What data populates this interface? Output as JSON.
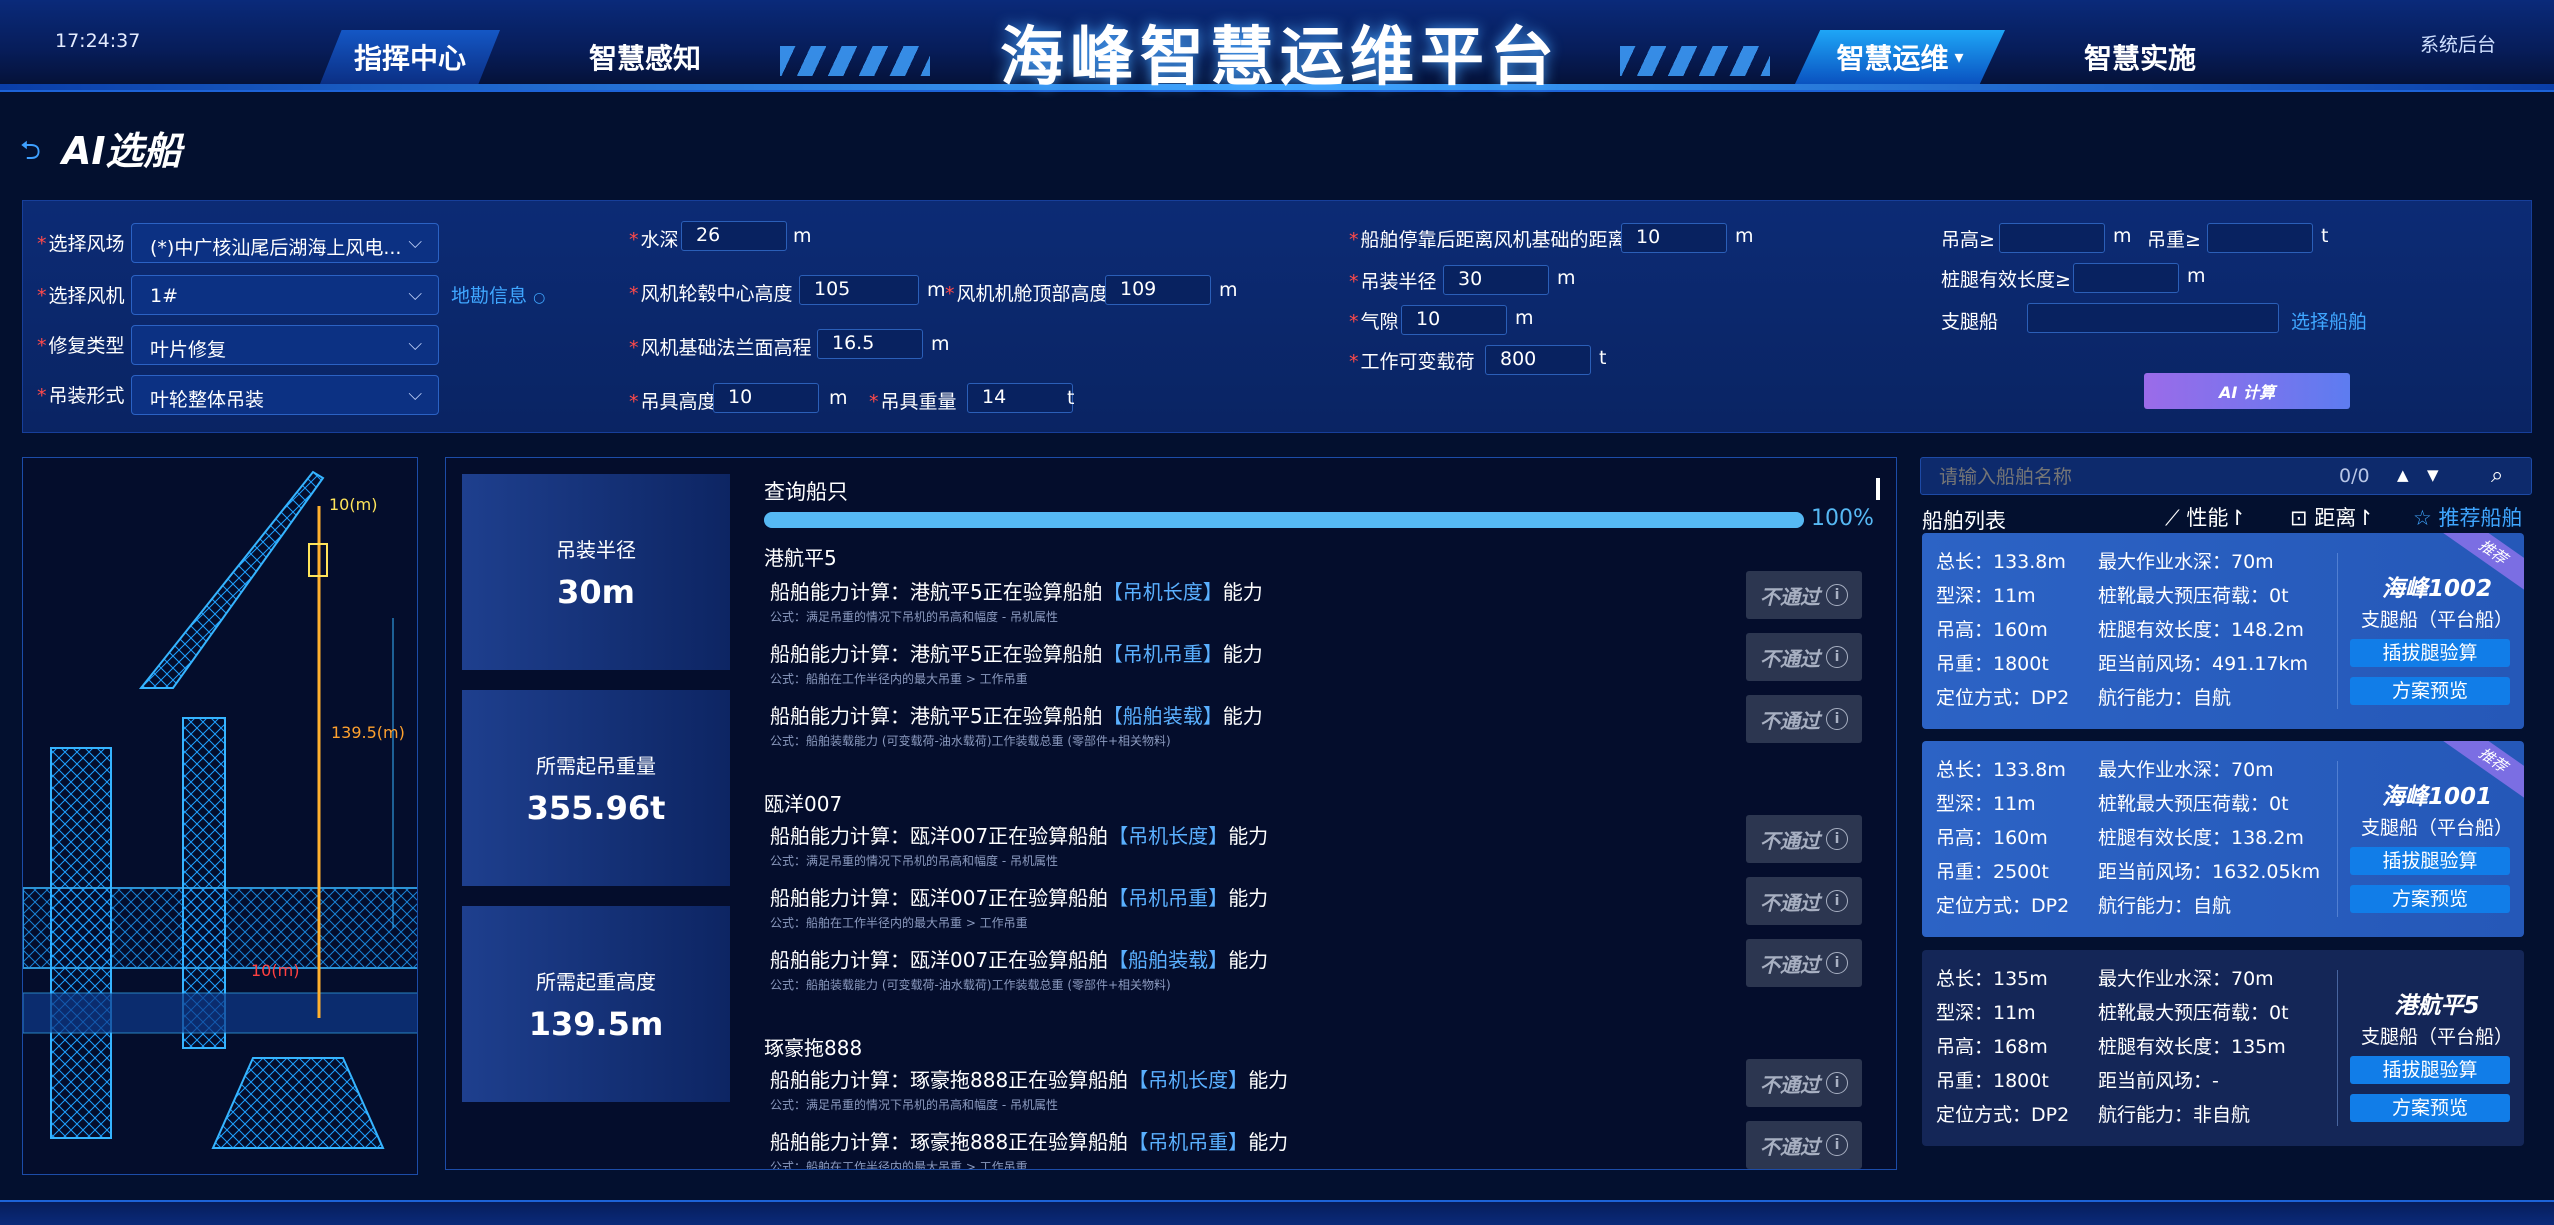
{
  "header": {
    "clock": "17:24:37",
    "title": "海峰智慧运维平台",
    "nav": [
      "指挥中心",
      "智慧感知",
      "智慧运维",
      "智慧实施"
    ],
    "nav_dropdown_arrow": "▾",
    "system_backend": "系统后台"
  },
  "page": {
    "title": "AI选船",
    "back_icon": "back-arrow-icon"
  },
  "form": {
    "wind_farm_label": "选择风场",
    "wind_farm_value": "(*)中广核汕尾后湖海上风电...",
    "turbine_label": "选择风机",
    "turbine_value": "1#",
    "repair_type_label": "修复类型",
    "repair_type_value": "叶片修复",
    "lift_form_label": "吊装形式",
    "lift_form_value": "叶轮整体吊装",
    "survey_link": "地勘信息",
    "water_depth_label": "水深",
    "water_depth_value": "26",
    "hub_height_label": "风机轮毂中心高度",
    "hub_height_value": "105",
    "nacelle_top_label": "风机机舱顶部高度",
    "nacelle_top_value": "109",
    "flange_label": "风机基础法兰面高程",
    "flange_value": "16.5",
    "rig_height_label": "吊具高度",
    "rig_height_value": "10",
    "rig_weight_label": "吊具重量",
    "rig_weight_value": "14",
    "dock_distance_label": "船舶停靠后距离风机基础的距离",
    "dock_distance_value": "10",
    "lift_radius_label": "吊装半径",
    "lift_radius_value": "30",
    "air_gap_label": "气隙",
    "air_gap_value": "10",
    "variable_load_label": "工作可变载荷",
    "variable_load_value": "800",
    "hook_height_label": "吊高≥",
    "hook_height_value": "",
    "hook_weight_label": "吊重≥",
    "hook_weight_value": "",
    "leg_length_label": "桩腿有效长度≥",
    "leg_length_value": "",
    "support_ship_label": "支腿船",
    "support_ship_value": "",
    "select_ship_link": "选择船舶",
    "ai_button": "AI 计算",
    "units": {
      "m": "m",
      "t": "t"
    }
  },
  "crane_image": {
    "label_top": "10(m)",
    "label_mid": "139.5(m)",
    "label_bottom": "10(m)"
  },
  "summary": [
    {
      "label": "吊装半径",
      "value": "30m"
    },
    {
      "label": "所需起吊重量",
      "value": "355.96t"
    },
    {
      "label": "所需起重高度",
      "value": "139.5m"
    }
  ],
  "query": {
    "title": "查询船只",
    "progress": 100,
    "progress_text": "100%",
    "ships": [
      {
        "name": "港航平5",
        "checks": [
          {
            "pre": "船舶能力计算：港航平5正在验算船舶",
            "hl": "【吊机长度】",
            "post": "能力",
            "formula": "公式：满足吊重的情况下吊机的吊高和幅度 - 吊机属性",
            "result": "不通过"
          },
          {
            "pre": "船舶能力计算：港航平5正在验算船舶",
            "hl": "【吊机吊重】",
            "post": "能力",
            "formula": "公式：船舶在工作半径内的最大吊重 > 工作吊重",
            "result": "不通过"
          },
          {
            "pre": "船舶能力计算：港航平5正在验算船舶",
            "hl": "【船舶装载】",
            "post": "能力",
            "formula": "公式：船舶装载能力 (可变载荷-油水载荷)工作装载总重 (零部件+相关物料)",
            "result": "不通过"
          }
        ]
      },
      {
        "name": "瓯洋007",
        "checks": [
          {
            "pre": "船舶能力计算：瓯洋007正在验算船舶",
            "hl": "【吊机长度】",
            "post": "能力",
            "formula": "公式：满足吊重的情况下吊机的吊高和幅度 - 吊机属性",
            "result": "不通过"
          },
          {
            "pre": "船舶能力计算：瓯洋007正在验算船舶",
            "hl": "【吊机吊重】",
            "post": "能力",
            "formula": "公式：船舶在工作半径内的最大吊重 > 工作吊重",
            "result": "不通过"
          },
          {
            "pre": "船舶能力计算：瓯洋007正在验算船舶",
            "hl": "【船舶装载】",
            "post": "能力",
            "formula": "公式：船舶装载能力 (可变载荷-油水载荷)工作装载总重 (零部件+相关物料)",
            "result": "不通过"
          }
        ]
      },
      {
        "name": "琢豪拖888",
        "checks": [
          {
            "pre": "船舶能力计算：琢豪拖888正在验算船舶",
            "hl": "【吊机长度】",
            "post": "能力",
            "formula": "公式：满足吊重的情况下吊机的吊高和幅度 - 吊机属性",
            "result": "不通过"
          },
          {
            "pre": "船舶能力计算：琢豪拖888正在验算船舶",
            "hl": "【吊机吊重】",
            "post": "能力",
            "formula": "公式：船舶在工作半径内的最大吊重 > 工作吊重",
            "result": "不通过"
          }
        ]
      }
    ]
  },
  "right": {
    "search_placeholder": "请输入船舶名称",
    "search_count": "0/0",
    "list_title": "船舶列表",
    "sort_perf": "性能",
    "sort_dist": "距离",
    "recommend_link": "推荐船舶",
    "ships": [
      {
        "recommended": true,
        "ribbon": "推荐",
        "name": "海峰1002",
        "type": "支腿船（平台船）",
        "col1": [
          "总长：133.8m",
          "型深：11m",
          "吊高：160m",
          "吊重：1800t",
          "定位方式：DP2"
        ],
        "col2": [
          "最大作业水深：70m",
          "桩靴最大预压荷载：0t",
          "桩腿有效长度：148.2m",
          "距当前风场：491.17km",
          "航行能力：自航"
        ],
        "btn1": "插拔腿验算",
        "btn2": "方案预览"
      },
      {
        "recommended": true,
        "ribbon": "推荐",
        "name": "海峰1001",
        "type": "支腿船（平台船）",
        "col1": [
          "总长：133.8m",
          "型深：11m",
          "吊高：160m",
          "吊重：2500t",
          "定位方式：DP2"
        ],
        "col2": [
          "最大作业水深：70m",
          "桩靴最大预压荷载：0t",
          "桩腿有效长度：138.2m",
          "距当前风场：1632.05km",
          "航行能力：自航"
        ],
        "btn1": "插拔腿验算",
        "btn2": "方案预览"
      },
      {
        "recommended": false,
        "ribbon": "",
        "name": "港航平5",
        "type": "支腿船（平台船）",
        "col1": [
          "总长：135m",
          "型深：11m",
          "吊高：168m",
          "吊重：1800t",
          "定位方式：DP2"
        ],
        "col2": [
          "最大作业水深：70m",
          "桩靴最大预压荷载：0t",
          "桩腿有效长度：135m",
          "距当前风场：-",
          "航行能力：非自航"
        ],
        "btn1": "插拔腿验算",
        "btn2": "方案预览"
      }
    ]
  },
  "colors": {
    "accent": "#3fa6ff",
    "progress": "#56b8f3",
    "required": "#ff4a4a",
    "fail_bg": "#2c3650"
  }
}
